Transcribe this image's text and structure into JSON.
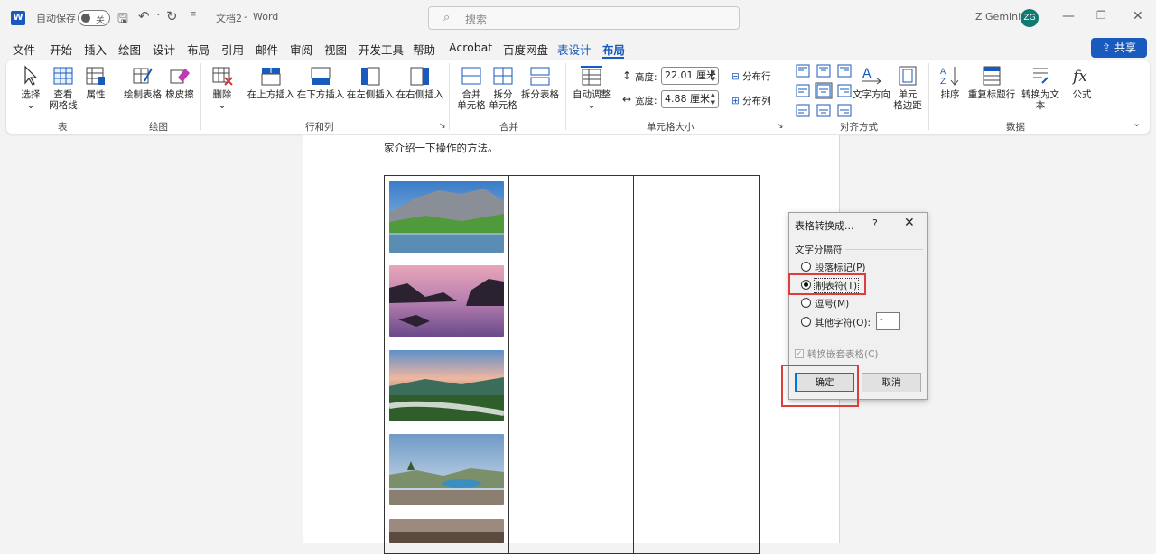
{
  "titlebar": {
    "autosave_label": "自动保存",
    "autosave_state": "关",
    "doc_title": "文档2",
    "separator": "-",
    "app_name": "Word",
    "search_placeholder": "搜索",
    "user_name": "Z Gemini",
    "user_initials": "ZG"
  },
  "menu": {
    "items": [
      "文件",
      "开始",
      "插入",
      "绘图",
      "设计",
      "布局",
      "引用",
      "邮件",
      "审阅",
      "视图",
      "开发工具",
      "帮助",
      "Acrobat",
      "百度网盘",
      "表设计",
      "布局"
    ],
    "share_label": "共享"
  },
  "ribbon": {
    "select": "选择",
    "view_gridlines": [
      "查看",
      "网格线"
    ],
    "properties": "属性",
    "draw_table": "绘制表格",
    "eraser": "橡皮擦",
    "delete": "删除",
    "insert_above": "在上方插入",
    "insert_below": "在下方插入",
    "insert_left": "在左侧插入",
    "insert_right": "在右侧插入",
    "merge_cells": [
      "合并",
      "单元格"
    ],
    "split_cells": [
      "拆分",
      "单元格"
    ],
    "split_table": "拆分表格",
    "autofit": "自动调整",
    "height_label": "高度:",
    "height_value": "22.01 厘米",
    "width_label": "宽度:",
    "width_value": "4.88 厘米",
    "distribute_rows": "分布行",
    "distribute_cols": "分布列",
    "text_direction": "文字方向",
    "cell_margins": [
      "单元",
      "格边距"
    ],
    "sort": "排序",
    "repeat_header": "重复标题行",
    "convert_to_text": "转换为文本",
    "formula": "公式",
    "groups": {
      "table": "表",
      "draw": "绘图",
      "rows_cols": "行和列",
      "merge": "合并",
      "cell_size": "单元格大小",
      "alignment": "对齐方式",
      "data": "数据"
    }
  },
  "document": {
    "text": "家介绍一下操作的方法。"
  },
  "dialog": {
    "title": "表格转换成...",
    "help": "?",
    "close": "✕",
    "section": "文字分隔符",
    "options": [
      "段落标记(P)",
      "制表符(T)",
      "逗号(M)",
      "其他字符(O):"
    ],
    "selected_option": "制表符(T)",
    "other_char_value": "-",
    "nested_label": "转换嵌套表格(C)",
    "ok": "确定",
    "cancel": "取消"
  },
  "colors": {
    "accent": "#185abd",
    "highlight_box": "#e03c3c",
    "avatar": "#0e7a70"
  }
}
